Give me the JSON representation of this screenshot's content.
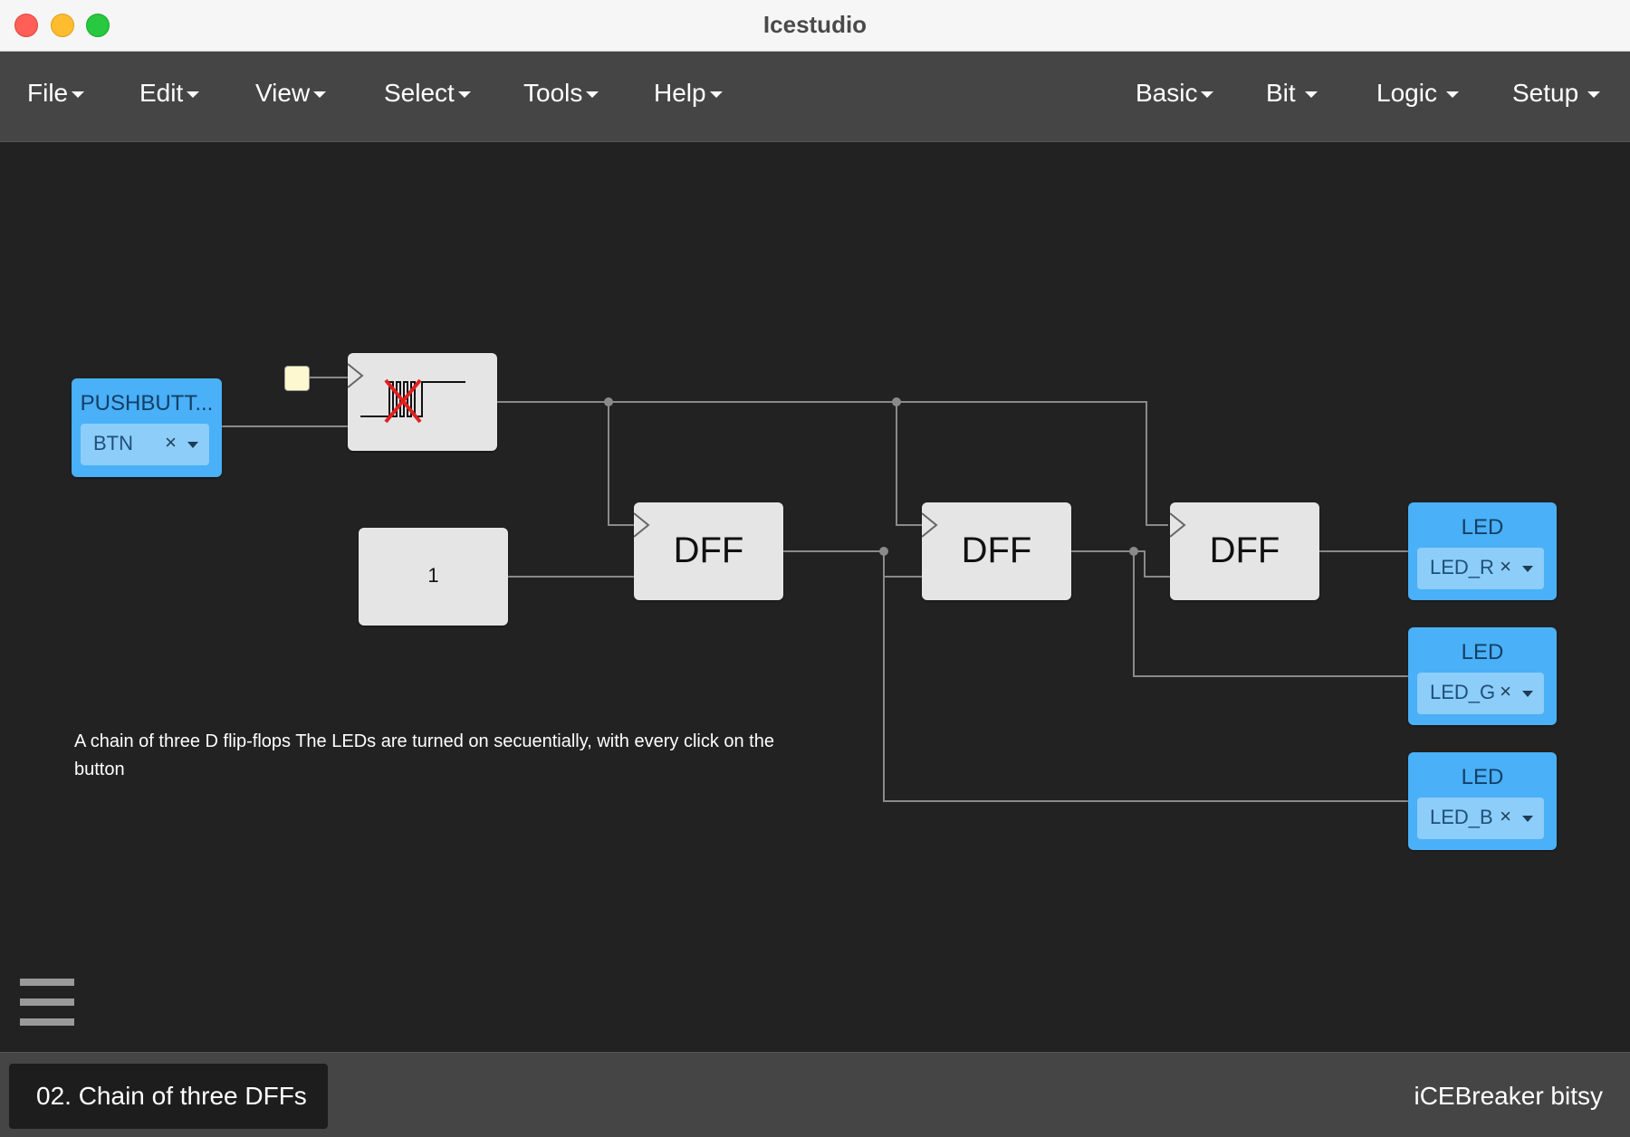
{
  "window": {
    "title": "Icestudio"
  },
  "menubar": {
    "left_menus": [
      {
        "label": "File"
      },
      {
        "label": "Edit"
      },
      {
        "label": "View"
      },
      {
        "label": "Select"
      },
      {
        "label": "Tools"
      },
      {
        "label": "Help"
      }
    ],
    "right_menus": [
      {
        "label": "Basic"
      },
      {
        "label": "Bit"
      },
      {
        "label": "Logic"
      },
      {
        "label": "Setup"
      }
    ]
  },
  "canvas": {
    "input_block": {
      "title": "PUSHBUTT...",
      "pin": "BTN",
      "clear_symbol": "×"
    },
    "constant_block": {
      "value": "1"
    },
    "dff_blocks": [
      {
        "label": "DFF"
      },
      {
        "label": "DFF"
      },
      {
        "label": "DFF"
      }
    ],
    "led_blocks": [
      {
        "title": "LED",
        "pin": "LED_R",
        "clear_symbol": "×"
      },
      {
        "title": "LED",
        "pin": "LED_G",
        "clear_symbol": "×"
      },
      {
        "title": "LED",
        "pin": "LED_B",
        "clear_symbol": "×"
      }
    ],
    "comment": "A chain of three D flip-flops The LEDs are turned on secuentially, with every click on the button",
    "colors": {
      "canvas_bg": "#222222",
      "block_bg": "#e5e5e5",
      "io_block_bg": "#4ab0f7",
      "wire": "#8a8a8a",
      "debouncer_cross": "#e0201f"
    }
  },
  "footer": {
    "project_tab": "02. Chain of three DFFs",
    "board": "iCEBreaker bitsy"
  }
}
